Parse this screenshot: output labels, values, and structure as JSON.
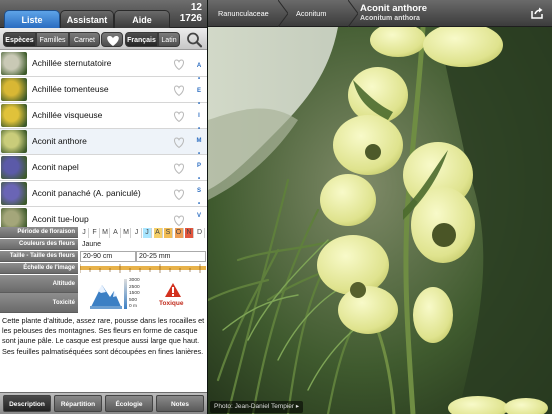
{
  "tabs": {
    "liste": "Liste",
    "assistant": "Assistant",
    "aide": "Aide"
  },
  "counter": {
    "top": "12",
    "bottom": "1726"
  },
  "filters": {
    "especes": "Espèces",
    "familles": "Familles",
    "carnet": "Carnet",
    "francais": "Français",
    "latin": "Latin"
  },
  "icons": {
    "heart": "heart-icon",
    "search": "search-icon",
    "share": "share-icon",
    "warning": "warning-icon"
  },
  "species": [
    {
      "name": "Achillée sternutatoire",
      "color": "#c9c9b5"
    },
    {
      "name": "Achillée tomenteuse",
      "color": "#d8b734"
    },
    {
      "name": "Achillée visqueuse",
      "color": "#e0c23a"
    },
    {
      "name": "Aconit anthore",
      "color": "#c9cc7a"
    },
    {
      "name": "Aconit napel",
      "color": "#5b5aa8"
    },
    {
      "name": "Aconit panaché (A. paniculé)",
      "color": "#6a65b5"
    },
    {
      "name": "Aconit tue-loup",
      "color": "#a4a67a"
    }
  ],
  "alphabet": [
    "A",
    "•",
    "E",
    "•",
    "I",
    "•",
    "M",
    "•",
    "P",
    "•",
    "S",
    "•",
    "V"
  ],
  "attributes": {
    "flowering_label": "Période de floraison",
    "months": [
      "J",
      "F",
      "M",
      "A",
      "M",
      "J",
      "J",
      "A",
      "S",
      "O",
      "N",
      "D"
    ],
    "flowering_colors": [
      "",
      "",
      "",
      "",
      "",
      "",
      "#a9e6ff",
      "#f5d06a",
      "#f2bd55",
      "#ee9d55",
      "#e2553e",
      ""
    ],
    "flower_color_label": "Couleurs des fleurs",
    "flower_color_value": "Jaune",
    "size_label": "Taille - Taille des fleurs",
    "plant_size": "20-90 cm",
    "flower_size": "20-25 mm",
    "scale_label": "Échelle de l'image",
    "altitude_label": "Altitude",
    "altitude_ticks": [
      "3000",
      "2500",
      "1500",
      "500",
      "0 m"
    ],
    "toxicity_label": "Toxicité",
    "toxicity_value": "Toxique"
  },
  "description": "Cette plante d'altitude, assez rare, pousse dans les rocailles et les pelouses des montagnes. Ses fleurs en forme de casque sont jaune pâle. Le casque est presque aussi large que haut. Ses feuilles palmatiséquées sont découpées en fines lanières.",
  "bottom_tabs": [
    "Description",
    "Répartition",
    "Écologie",
    "Notes"
  ],
  "breadcrumb": {
    "family": "Ranunculaceae",
    "genus": "Aconitum",
    "title": "Aconit anthore",
    "subtitle": "Aconitum anthora"
  },
  "photo_credit": "Photo: Jean-Daniel Tempier ▸"
}
